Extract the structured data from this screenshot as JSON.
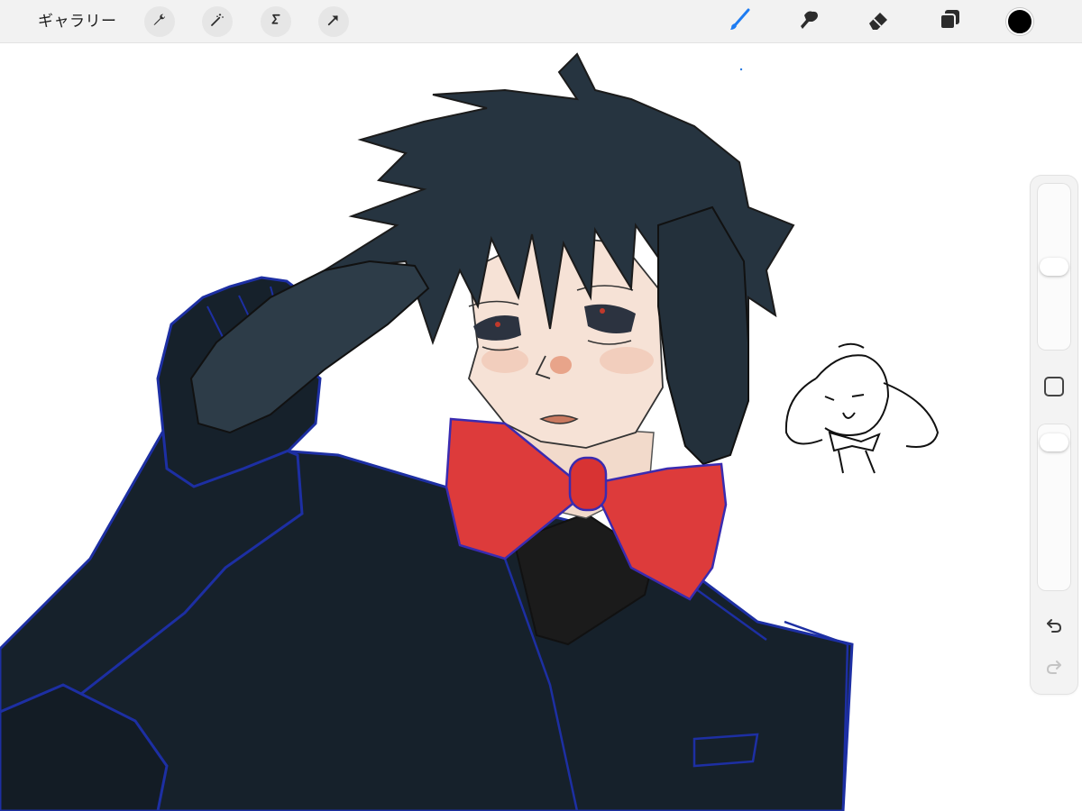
{
  "toolbar": {
    "gallery_label": "ギャラリー",
    "left_tools": [
      {
        "icon": "wrench-icon",
        "name": "actions"
      },
      {
        "icon": "magic-wand-icon",
        "name": "adjustments"
      },
      {
        "icon": "selection-icon",
        "name": "selection"
      },
      {
        "icon": "arrow-cursor-icon",
        "name": "transform"
      }
    ],
    "right_tools": [
      {
        "icon": "brush-icon",
        "name": "paint",
        "active": true
      },
      {
        "icon": "smudge-icon",
        "name": "smudge",
        "active": false
      },
      {
        "icon": "eraser-icon",
        "name": "eraser",
        "active": false
      },
      {
        "icon": "layers-icon",
        "name": "layers",
        "active": false
      }
    ],
    "current_color": "#000000"
  },
  "sidebar": {
    "brush_size_level": 0.5,
    "opacity_level": 0.95,
    "modify_icon": "square-icon",
    "undo_icon": "undo-arrow-icon",
    "redo_icon": "redo-arrow-icon"
  },
  "colors": {
    "active_tool": "#1e7cf2",
    "inactive_tool": "#2c2c2c",
    "toolbar_bg": "#f2f2f2",
    "hair": "#263440",
    "jacket": "#16212b",
    "outline_blue": "#1d2fa3",
    "bow_red": "#dd3b3b",
    "skin": "#f6e2d6"
  }
}
